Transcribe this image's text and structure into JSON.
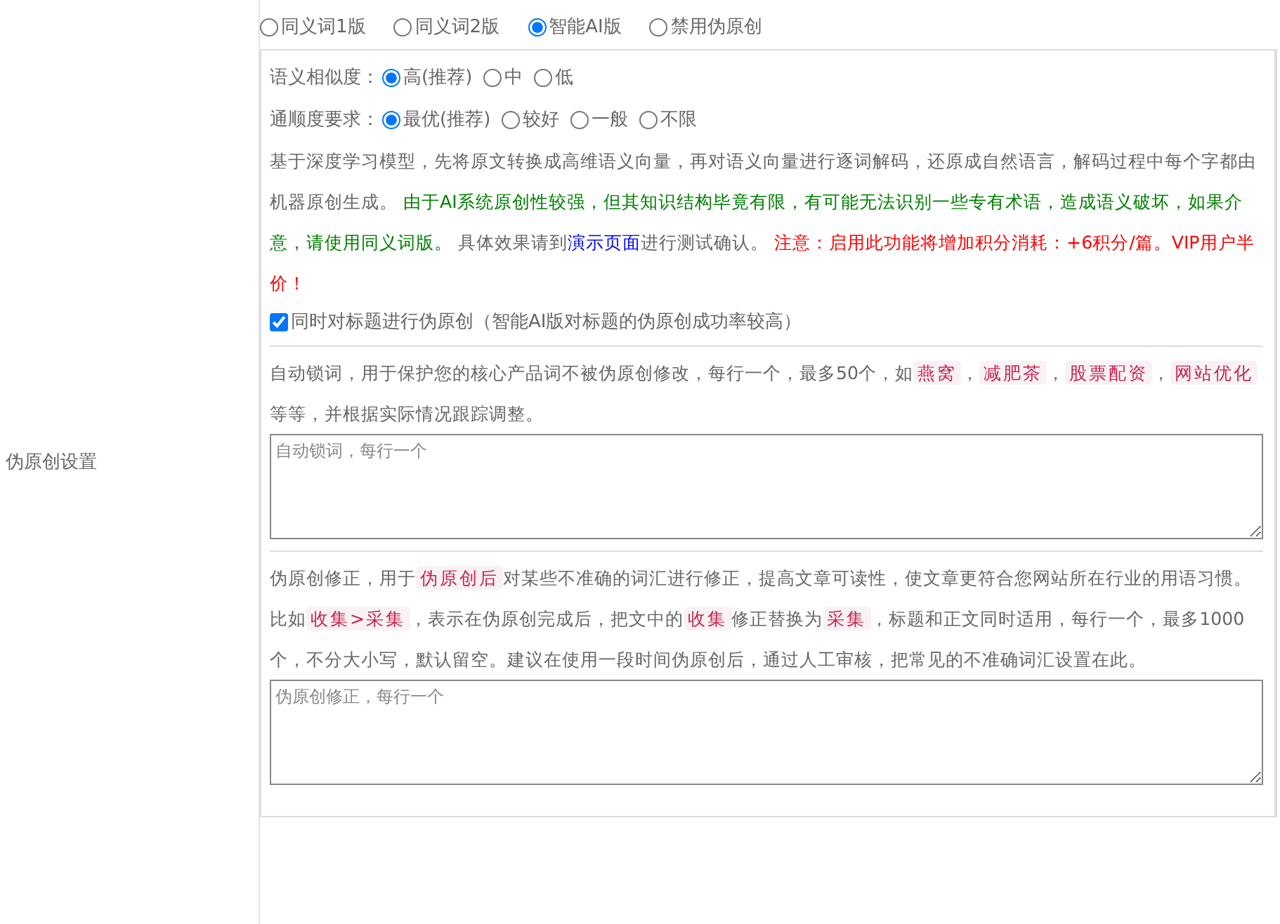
{
  "section_label": "伪原创设置",
  "modes": [
    {
      "label": "同义词1版",
      "selected": false
    },
    {
      "label": "同义词2版",
      "selected": false
    },
    {
      "label": "智能AI版",
      "selected": true
    },
    {
      "label": "禁用伪原创",
      "selected": false
    }
  ],
  "similarity": {
    "label": "语义相似度：",
    "options": [
      {
        "label": "高(推荐)",
        "selected": true
      },
      {
        "label": "中",
        "selected": false
      },
      {
        "label": "低",
        "selected": false
      }
    ]
  },
  "fluency": {
    "label": "通顺度要求：",
    "options": [
      {
        "label": "最优(推荐)",
        "selected": true
      },
      {
        "label": "较好",
        "selected": false
      },
      {
        "label": "一般",
        "selected": false
      },
      {
        "label": "不限",
        "selected": false
      }
    ]
  },
  "ai_description": [
    {
      "kind": "text",
      "text": "基于深度学习模型，先将原文转换成高维语义向量，再对语义向量进行逐词解码，还原成自然语言，解码过程中每个字都由机器原创生成。 "
    },
    {
      "kind": "green",
      "text": "由于AI系统原创性较强，但其知识结构毕竟有限，有可能无法识别一些专有术语，造成语义破坏，如果介意，请使用同义词版。"
    },
    {
      "kind": "text",
      "text": " 具体效果请到"
    },
    {
      "kind": "link",
      "text": "演示页面"
    },
    {
      "kind": "text",
      "text": "进行测试确认。 "
    },
    {
      "kind": "red",
      "text": "注意：启用此功能将增加积分消耗：+6积分/篇。VIP用户半价！"
    }
  ],
  "title_option": {
    "label": "同时对标题进行伪原创（智能AI版对标题的伪原创成功率较高）",
    "checked": true
  },
  "lock_description": [
    {
      "kind": "text",
      "text": "自动锁词，用于保护您的核心产品词不被伪原创修改，每行一个，最多50个，如"
    },
    {
      "kind": "tag",
      "text": "燕窝"
    },
    {
      "kind": "text",
      "text": "，"
    },
    {
      "kind": "tag",
      "text": "减肥茶"
    },
    {
      "kind": "text",
      "text": "，"
    },
    {
      "kind": "tag",
      "text": "股票配资"
    },
    {
      "kind": "text",
      "text": "，"
    },
    {
      "kind": "tag",
      "text": "网站优化"
    },
    {
      "kind": "text",
      "text": "等等，并根据实际情况跟踪调整。"
    }
  ],
  "lock_field": {
    "placeholder": "自动锁词，每行一个"
  },
  "correction_description": [
    {
      "kind": "text",
      "text": "伪原创修正，用于"
    },
    {
      "kind": "tag",
      "text": "伪原创后"
    },
    {
      "kind": "text",
      "text": "对某些不准确的词汇进行修正，提高文章可读性，使文章更符合您网站所在行业的用语习惯。比如"
    },
    {
      "kind": "tag",
      "text": "收集>采集"
    },
    {
      "kind": "text",
      "text": "，表示在伪原创完成后，把文中的"
    },
    {
      "kind": "tag",
      "text": "收集"
    },
    {
      "kind": "text",
      "text": "修正替换为"
    },
    {
      "kind": "tag",
      "text": "采集"
    },
    {
      "kind": "text",
      "text": "，标题和正文同时适用，每行一个，最多1000个，不分大小写，默认留空。建议在使用一段时间伪原创后，通过人工审核，把常见的不准确词汇设置在此。"
    }
  ],
  "correction_field": {
    "placeholder": "伪原创修正，每行一个"
  }
}
